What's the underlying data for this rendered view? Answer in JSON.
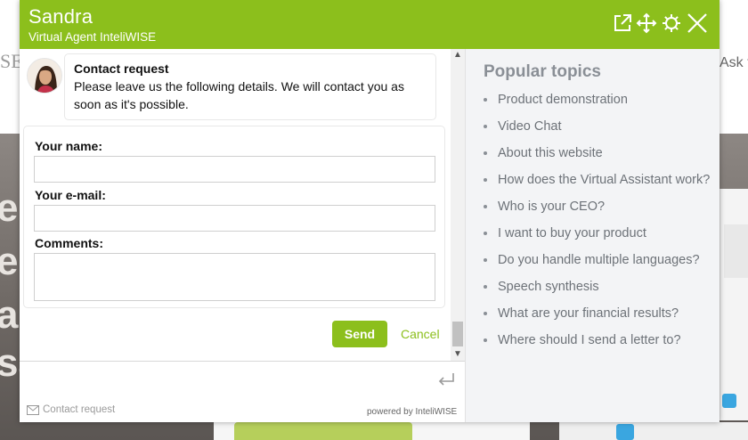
{
  "background": {
    "left_fragment": "SE",
    "right_fragment": "Ask fo",
    "big_letters": [
      "e",
      "e v",
      "an",
      "sa"
    ]
  },
  "header": {
    "agent_name": "Sandra",
    "agent_subtitle": "Virtual Agent InteliWISE",
    "accent_color": "#8cbf1c"
  },
  "chat": {
    "bubble_title": "Contact request",
    "bubble_text": "Please leave us the following details. We will contact you as soon as it's possible."
  },
  "form": {
    "name_label": "Your name:",
    "name_value": "",
    "email_label": "Your e-mail:",
    "email_value": "",
    "comments_label": "Comments:",
    "comments_value": "",
    "send_label": "Send",
    "cancel_label": "Cancel"
  },
  "input": {
    "placeholder": ""
  },
  "footer": {
    "contact_label": "Contact request",
    "powered_label": "powered by InteliWISE"
  },
  "topics": {
    "heading": "Popular topics",
    "items": [
      "Product demonstration",
      "Video Chat",
      "About this website",
      "How does the Virtual Assistant work?",
      "Who is your CEO?",
      "I want to buy your product",
      "Do you handle multiple languages?",
      "Speech synthesis",
      "What are your financial results?",
      "Where should I send a letter to?"
    ]
  }
}
